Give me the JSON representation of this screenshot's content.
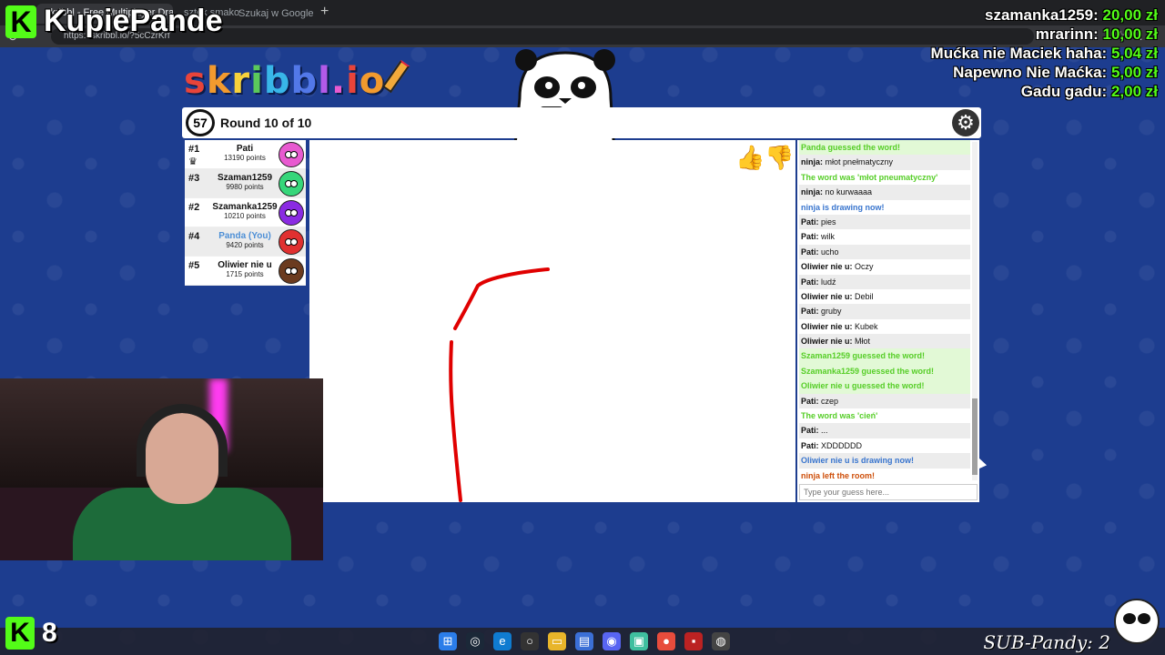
{
  "browser": {
    "tabs": [
      {
        "title": "skribbl - Free Multiplayer Drawin",
        "active": true
      },
      {
        "title": "sztek smako",
        "active": false
      },
      {
        "title": "Szukaj w Google",
        "active": false
      }
    ],
    "url": "https://skribbl.io/?5cCzrKrf"
  },
  "stream": {
    "channel_name": "KupiePande",
    "viewer_count": "8",
    "sub_counter": "SUB-Pandy: 2",
    "brand_color": "#53fc18"
  },
  "donations": [
    {
      "name": "szamanka1259:",
      "amount": "20,00 zł"
    },
    {
      "name": "mrarinn:",
      "amount": "10,00 zł"
    },
    {
      "name": "Mućka nie Maciek haha:",
      "amount": "5,04 zł"
    },
    {
      "name": "Napewno Nie Maćka:",
      "amount": "5,00 zł"
    },
    {
      "name": "Gadu gadu:",
      "amount": "2,00 zł"
    }
  ],
  "game": {
    "logo_letters": [
      {
        "ch": "s",
        "color": "#e8443a"
      },
      {
        "ch": "k",
        "color": "#f29a2e"
      },
      {
        "ch": "r",
        "color": "#f7d13b"
      },
      {
        "ch": "i",
        "color": "#5bc95b"
      },
      {
        "ch": "b",
        "color": "#38b6e8"
      },
      {
        "ch": "b",
        "color": "#5278e8"
      },
      {
        "ch": "l",
        "color": "#b35ae8"
      },
      {
        "ch": ".",
        "color": "#e85ad0"
      },
      {
        "ch": "i",
        "color": "#e8443a"
      },
      {
        "ch": "o",
        "color": "#f29a2e"
      }
    ],
    "timer": "57",
    "round": "Round 10 of 10",
    "players": [
      {
        "rank": "#1",
        "name": "Pati",
        "points": "13190 points",
        "avatar_color": "#e85ad0",
        "crown": true,
        "you": false
      },
      {
        "rank": "#3",
        "name": "Szaman1259",
        "points": "9980 points",
        "avatar_color": "#36d67a",
        "crown": false,
        "you": false
      },
      {
        "rank": "#2",
        "name": "Szamanka1259",
        "points": "10210 points",
        "avatar_color": "#8a2be2",
        "crown": false,
        "you": false
      },
      {
        "rank": "#4",
        "name": "Panda (You)",
        "points": "9420 points",
        "avatar_color": "#e03030",
        "crown": false,
        "you": true
      },
      {
        "rank": "#5",
        "name": "Oliwier nie u",
        "points": "1715 points",
        "avatar_color": "#6b3b1f",
        "crown": false,
        "you": false
      }
    ],
    "chat": [
      {
        "type": "guess",
        "text": "Panda guessed the word!"
      },
      {
        "type": "msg",
        "author": "ninja:",
        "text": "młot pnełmatyczny"
      },
      {
        "type": "system-green",
        "text": "The word was 'młot pneumatyczny'"
      },
      {
        "type": "msg",
        "author": "ninja:",
        "text": "no kurwaaaa"
      },
      {
        "type": "drawing",
        "text": "ninja is drawing now!"
      },
      {
        "type": "msg",
        "author": "Pati:",
        "text": "pies"
      },
      {
        "type": "msg",
        "author": "Pati:",
        "text": "wilk"
      },
      {
        "type": "msg",
        "author": "Pati:",
        "text": "ucho"
      },
      {
        "type": "msg",
        "author": "Oliwier nie u:",
        "text": "Oczy"
      },
      {
        "type": "msg",
        "author": "Pati:",
        "text": "ludź"
      },
      {
        "type": "msg",
        "author": "Oliwier nie u:",
        "text": "Debil"
      },
      {
        "type": "msg",
        "author": "Pati:",
        "text": "gruby"
      },
      {
        "type": "msg",
        "author": "Oliwier nie u:",
        "text": "Kubek"
      },
      {
        "type": "msg",
        "author": "Oliwier nie u:",
        "text": "Młot"
      },
      {
        "type": "guess",
        "text": "Szaman1259 guessed the word!"
      },
      {
        "type": "guess",
        "text": "Szamanka1259 guessed the word!"
      },
      {
        "type": "guess",
        "text": "Oliwier nie u guessed the word!"
      },
      {
        "type": "msg",
        "author": "Pati:",
        "text": "czep"
      },
      {
        "type": "system-green",
        "text": "The word was 'cień'"
      },
      {
        "type": "msg",
        "author": "Pati:",
        "text": "..."
      },
      {
        "type": "msg",
        "author": "Pati:",
        "text": "XDDDDDD"
      },
      {
        "type": "drawing",
        "text": "Oliwier nie u is drawing now!"
      },
      {
        "type": "left",
        "text": "ninja left the room!"
      }
    ],
    "chat_placeholder": "Type your guess here...",
    "drawing_color": "#e00000"
  }
}
